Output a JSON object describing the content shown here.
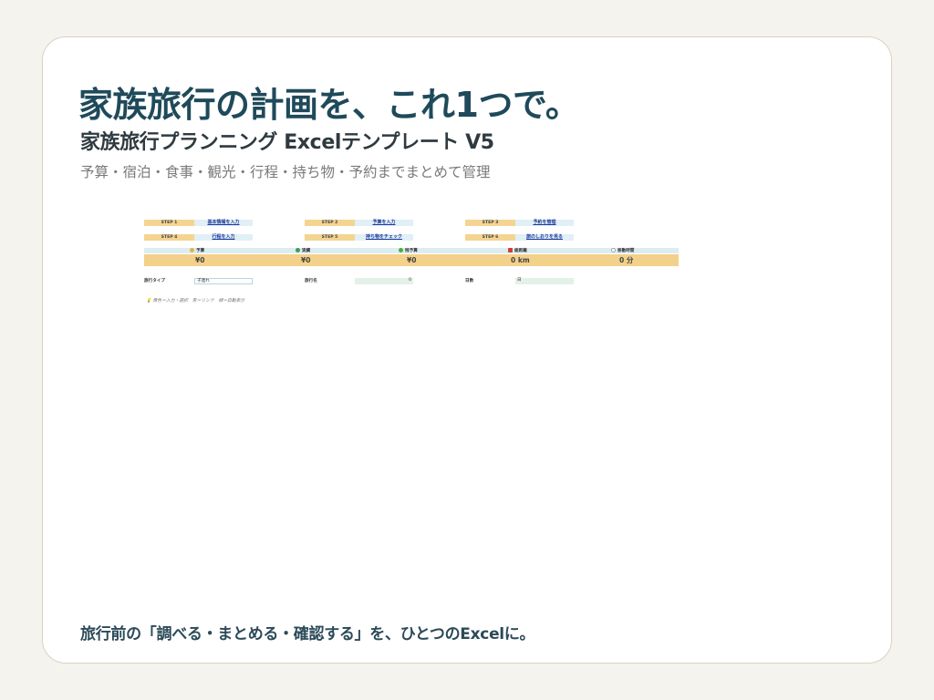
{
  "hero": {
    "title": "家族旅行の計画を、これ1つで。",
    "subtitle": "家族旅行プランニング Excelテンプレート V5",
    "tagline": "予算・宿泊・食事・観光・行程・持ち物・予約までまとめて管理"
  },
  "sheet": {
    "steps": [
      {
        "label": "STEP 1",
        "link": "基本情報を入力"
      },
      {
        "label": "STEP 2",
        "link": "予算を入力"
      },
      {
        "label": "STEP 3",
        "link": "予約を管理"
      },
      {
        "label": "STEP 4",
        "link": "行程を入力"
      },
      {
        "label": "STEP 5",
        "link": "持ち物をチェック"
      },
      {
        "label": "STEP 6",
        "link": "旅のしおりを見る"
      }
    ],
    "kpis": [
      {
        "label": "予算",
        "value": "¥0",
        "icon": "money-bag-icon",
        "color": "#e0b44a"
      },
      {
        "label": "実績",
        "value": "¥0",
        "icon": "recycle-icon",
        "color": "#3a9d5a"
      },
      {
        "label": "残予算",
        "value": "¥0",
        "icon": "green-circle-icon",
        "color": "#4cae3c"
      },
      {
        "label": "総距離",
        "value": "0 km",
        "icon": "car-icon",
        "color": "#d23a3a"
      },
      {
        "label": "移動時間",
        "value": "0 分",
        "icon": "stopwatch-icon",
        "color": "#9aa6b0"
      }
    ],
    "fields": {
      "trip_type_label": "旅行タイプ",
      "trip_type_value": "子連れ",
      "trip_name_label": "旅行名",
      "trip_name_value": "0",
      "days_label": "日数",
      "days_value": "日"
    },
    "legend_note": "💡 黄色＝入力・選択　青＝リンク　緑＝自動表示"
  },
  "footer": {
    "text": "旅行前の「調べる・まとめる・確認する」を、ひとつのExcelに。"
  },
  "colors": {
    "title": "#1f4a5a",
    "input_yellow": "#f3d591",
    "link_blue": "#e1eff6",
    "auto_green": "#e3f1e8"
  }
}
